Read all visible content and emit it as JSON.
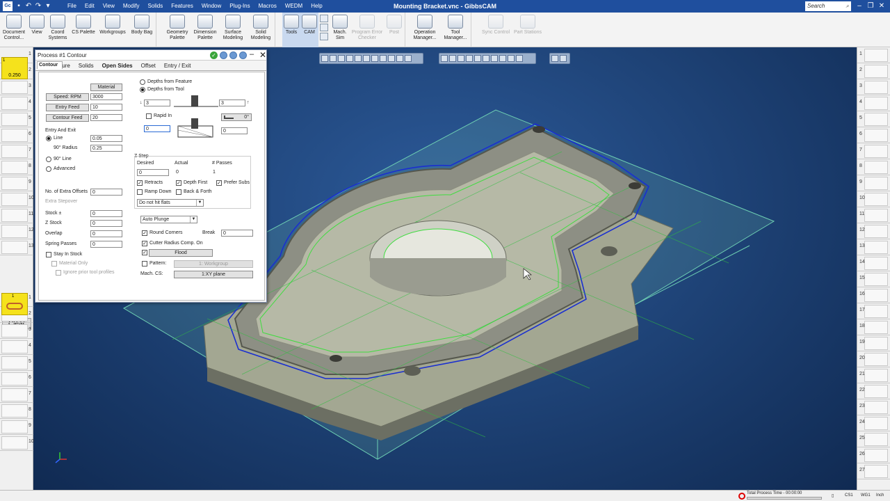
{
  "window": {
    "title": "Mounting Bracket.vnc - GibbsCAM",
    "search_placeholder": "Search",
    "logo": "Gc"
  },
  "menu": [
    "File",
    "Edit",
    "View",
    "Modify",
    "Solids",
    "Features",
    "Window",
    "Plug-Ins",
    "Macros",
    "WEDM",
    "Help"
  ],
  "ribbon": [
    {
      "label": "Document Control...",
      "icon": "document-control-icon",
      "state": "normal"
    },
    {
      "label": "View",
      "icon": "view-icon",
      "state": "normal"
    },
    {
      "label": "Coord Systems",
      "icon": "coord-systems-icon",
      "state": "normal"
    },
    {
      "label": "CS Palette",
      "icon": "cs-palette-icon",
      "state": "normal"
    },
    {
      "label": "Workgroups",
      "icon": "workgroups-icon",
      "state": "normal"
    },
    {
      "label": "Body Bag",
      "icon": "body-bag-icon",
      "state": "normal"
    },
    {
      "label": "Geometry Palette",
      "icon": "geometry-palette-icon",
      "state": "normal"
    },
    {
      "label": "Dimension Palette",
      "icon": "dimension-palette-icon",
      "state": "normal"
    },
    {
      "label": "Surface Modeling",
      "icon": "surface-modeling-icon",
      "state": "normal"
    },
    {
      "label": "Solid Modeling",
      "icon": "solid-modeling-icon",
      "state": "normal"
    },
    {
      "label": "Tools",
      "icon": "tools-icon",
      "state": "active"
    },
    {
      "label": "CAM",
      "icon": "cam-icon",
      "state": "active"
    },
    {
      "label": "Mach. Sim",
      "icon": "machine-sim-icon",
      "state": "normal"
    },
    {
      "label": "Program Error Checker",
      "icon": "program-error-checker-icon",
      "state": "disabled"
    },
    {
      "label": "Post",
      "icon": "post-icon",
      "state": "disabled"
    },
    {
      "label": "Operation Manager...",
      "icon": "operation-manager-icon",
      "state": "normal"
    },
    {
      "label": "Tool Manager...",
      "icon": "tool-manager-icon",
      "state": "normal"
    },
    {
      "label": "Sync Control",
      "icon": "sync-control-icon",
      "state": "disabled"
    },
    {
      "label": "Part Stations",
      "icon": "part-stations-icon",
      "state": "disabled"
    }
  ],
  "left_panel": {
    "tool_value": "0.250",
    "tool_slot": "1",
    "tool_numbers": [
      "1",
      "2",
      "3",
      "4",
      "5",
      "6",
      "7",
      "8",
      "9",
      "10",
      "11",
      "12",
      "13"
    ],
    "clear_label": "Clear",
    "process_slot": "1",
    "process_numbers": [
      "1",
      "2",
      "3",
      "4",
      "5",
      "6",
      "7",
      "8",
      "9",
      "10"
    ]
  },
  "right_panel": {
    "numbers": [
      "1",
      "2",
      "3",
      "4",
      "5",
      "6",
      "7",
      "8",
      "9",
      "10",
      "11",
      "12",
      "13",
      "14",
      "15",
      "16",
      "17",
      "18",
      "19",
      "20",
      "21",
      "22",
      "23",
      "24",
      "25",
      "26",
      "27"
    ]
  },
  "dialog": {
    "title": "Process #1 Contour",
    "tabs": [
      "Contour",
      "Mill Feature",
      "Solids",
      "Open Sides",
      "Offset",
      "Entry / Exit"
    ],
    "material_label": "Material",
    "speed_label": "Speed: RPM",
    "speed_value": "3000",
    "entry_feed_label": "Entry Feed",
    "entry_feed_value": "10",
    "contour_feed_label": "Contour Feed",
    "contour_feed_value": "20",
    "entry_exit_label": "Entry And Exit",
    "line_label": "Line",
    "line_value": "0.05",
    "radius_label": "90° Radius",
    "radius_value": "0.25",
    "ninety_line_label": "90° Line",
    "advanced_label": "Advanced",
    "extra_offsets_label": "No. of Extra Offsets",
    "extra_offsets_value": "0",
    "extra_stepover_label": "Extra Stepover",
    "stock_label": "Stock ±",
    "stock_value": "0",
    "zstock_label": "Z Stock",
    "zstock_value": "0",
    "overlap_label": "Overlap",
    "overlap_value": "0",
    "spring_label": "Spring Passes",
    "spring_value": "0",
    "stay_in_stock_label": "Stay In Stock",
    "material_only_label": "Material Only",
    "ignore_prior_label": "Ignore prior tool profiles",
    "depths_feature_label": "Depths from Feature",
    "depths_tool_label": "Depths from Tool",
    "depth_left_value": "3",
    "depth_right_value": "3",
    "rapid_in_label": "Rapid In",
    "angle_value": "0°",
    "lower_left_value": "0",
    "lower_right_value": "0",
    "zstep_label": "Z Step",
    "desired_label": "Desired",
    "actual_label": "Actual",
    "passes_label": "# Passes",
    "desired_value": "0",
    "actual_value": "0",
    "passes_value": "1",
    "retracts_label": "Retracts",
    "depth_first_label": "Depth First",
    "prefer_subs_label": "Prefer Subs",
    "ramp_down_label": "Ramp Down",
    "back_forth_label": "Back & Forth",
    "flats_value": "Do not hit flats",
    "plunge_value": "Auto Plunge",
    "round_corners_label": "Round Corners",
    "break_label": "Break",
    "break_value": "0",
    "cutter_comp_label": "Cutter Radius Comp. On",
    "flood_label": "Flood",
    "pattern_label": "Pattern:",
    "pattern_value": "1: Workgroup",
    "mach_cs_label": "Mach. CS:",
    "mach_cs_value": "1:XY plane"
  },
  "status": {
    "process_time": "Total Process Time - 00:00:00",
    "cs1": "CS1",
    "wg1": "WG1",
    "inch": "Inch"
  }
}
